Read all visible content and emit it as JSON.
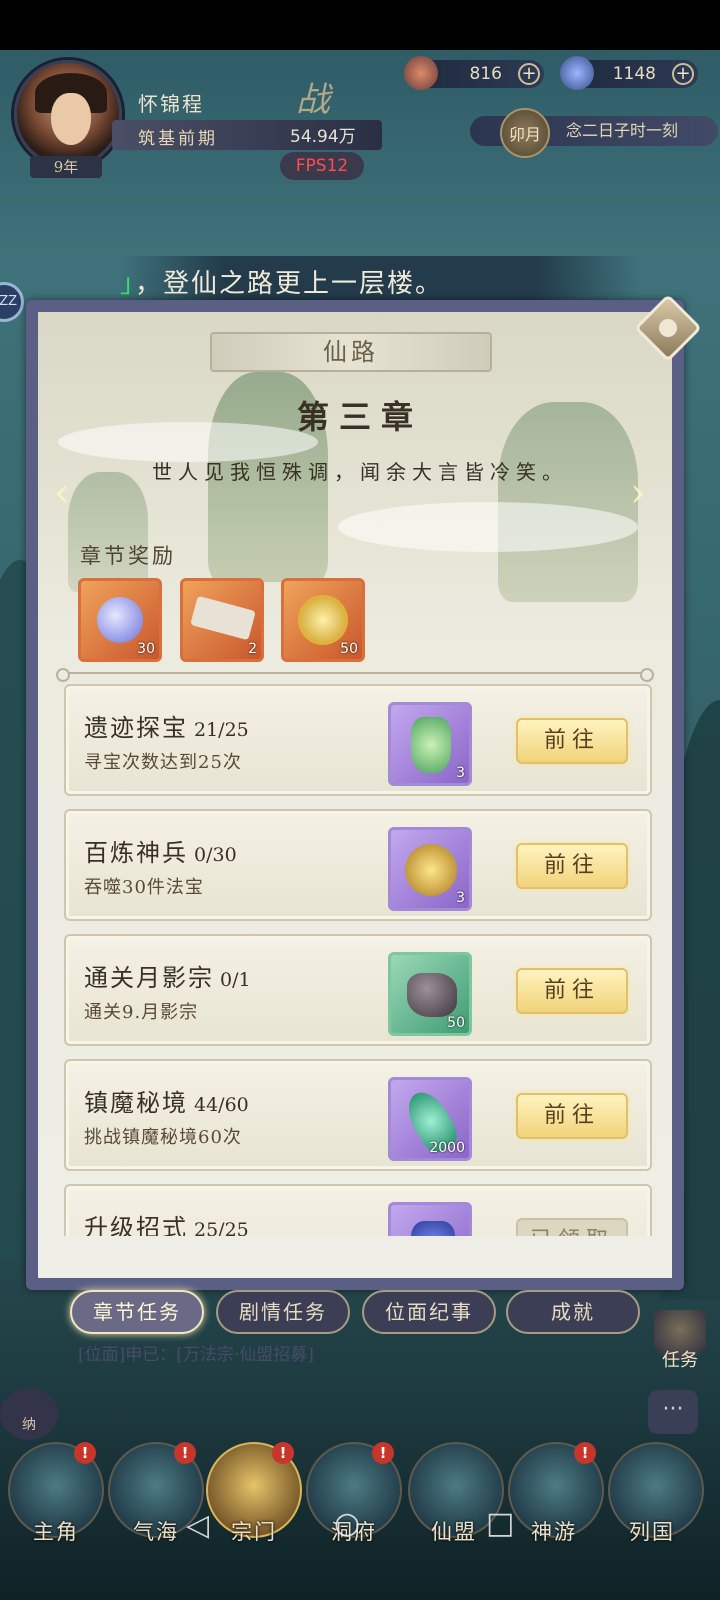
{
  "player": {
    "name": "怀锦程",
    "realm": "筑基前期",
    "power": "54.94万",
    "age": "9年",
    "fps": "FPS12"
  },
  "resources": [
    {
      "icon": "spirit-stone-icon",
      "value": "816"
    },
    {
      "icon": "jade-icon",
      "value": "1148"
    }
  ],
  "calendar": {
    "month": "卯月",
    "date": "念二日子时一刻"
  },
  "banner": {
    "quote_mark": "」",
    "text": "，登仙之路更上一层楼。"
  },
  "panel": {
    "title": "仙路",
    "chapter": "第三章",
    "poem": "世人见我恒殊调，闻余大言皆冷笑。",
    "reward_label": "章节奖励",
    "rewards": [
      {
        "icon": "crescent-jade-icon",
        "count": "30"
      },
      {
        "icon": "scroll-icon",
        "count": "2"
      },
      {
        "icon": "gold-coin-icon",
        "count": "50"
      }
    ],
    "tasks": [
      {
        "name": "遗迹探宝",
        "progress": "21/25",
        "desc": "寻宝次数达到25次",
        "item_icon": "jade-token-icon",
        "item_count": "3",
        "button": "前往"
      },
      {
        "name": "百炼神兵",
        "progress": "0/30",
        "desc": "吞噬30件法宝",
        "item_icon": "golden-beast-icon",
        "item_count": "3",
        "button": "前往"
      },
      {
        "name": "通关月影宗",
        "progress": "0/1",
        "desc": "通关9.月影宗",
        "item_icon": "ore-stone-icon",
        "item_count": "50",
        "button": "前往"
      },
      {
        "name": "镇魔秘境",
        "progress": "44/60",
        "desc": "挑战镇魔秘境60次",
        "item_icon": "jade-ruyi-icon",
        "item_count": "2000",
        "button": "前往"
      },
      {
        "name": "升级招式",
        "progress": "25/25",
        "desc": "",
        "item_icon": "blue-pouch-icon",
        "item_count": "",
        "button": "已领取"
      }
    ]
  },
  "tabs": [
    "章节任务",
    "剧情任务",
    "位面纪事",
    "成就"
  ],
  "feed_text": "[位面]申已：[万法宗·仙盟招募]",
  "side": {
    "task_label": "任务",
    "chat_icon": "chat-icon",
    "left_label": "纳"
  },
  "nav": [
    {
      "label": "主角",
      "badge": "!"
    },
    {
      "label": "气海",
      "badge": "!"
    },
    {
      "label": "宗门",
      "badge": "!"
    },
    {
      "label": "洞府",
      "badge": "!"
    },
    {
      "label": "仙盟",
      "badge": ""
    },
    {
      "label": "神游",
      "badge": "!"
    },
    {
      "label": "列国",
      "badge": ""
    }
  ],
  "system_nav": {
    "back": "◁",
    "home": "○",
    "recent": "□"
  },
  "accent_colors": {
    "button": "#f1d37a",
    "fps": "#ff4d4d",
    "quote": "#39e26a",
    "badge": "#c8352a"
  }
}
